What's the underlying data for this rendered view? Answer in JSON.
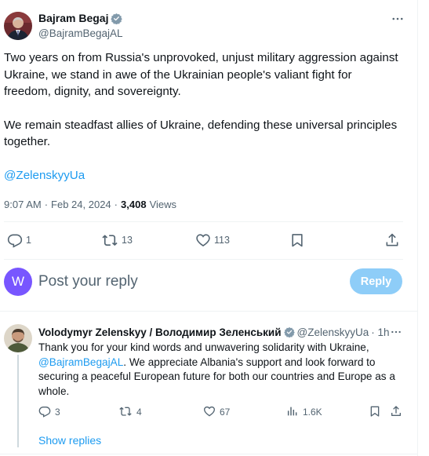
{
  "tweet": {
    "author_name": "Bajram Begaj",
    "author_handle": "@BajramBegajAL",
    "paragraph1": "Two years on from Russia's unprovoked, unjust military aggression against Ukraine, we stand in awe of the Ukrainian people's valiant fight for freedom, dignity, and sovereignty.",
    "paragraph2": "We remain steadfast allies of Ukraine, defending these universal principles together.",
    "mention": "@ZelenskyyUa",
    "time": "9:07 AM",
    "date": "Feb 24, 2024",
    "views_count": "3,408",
    "views_label": "Views",
    "replies": "1",
    "reposts": "13",
    "likes": "113"
  },
  "composer": {
    "avatar_letter": "W",
    "placeholder": "Post your reply",
    "button_label": "Reply"
  },
  "reply": {
    "author_name": "Volodymyr Zelenskyy / Володимир Зеленський",
    "author_handle": "@ZelenskyyUa",
    "age": "· 1h",
    "text_before": "Thank you for your kind words and unwavering solidarity with Ukraine,",
    "mention": "@BajramBegajAL",
    "text_after": ". We appreciate Albania's support and look forward to securing a peaceful European future for both our countries and Europe as a whole.",
    "replies": "3",
    "reposts": "4",
    "likes": "67",
    "views": "1.6K"
  },
  "show_replies_label": "Show replies",
  "colors": {
    "link": "#1d9bf0",
    "reply_button": "#8ecdf8",
    "composer_avatar": "#7856ff",
    "verified_badge": "#829aab"
  },
  "icons": [
    "verified-badge-icon",
    "more-icon",
    "reply-icon",
    "repost-icon",
    "like-icon",
    "bookmark-icon",
    "share-icon",
    "views-icon"
  ]
}
